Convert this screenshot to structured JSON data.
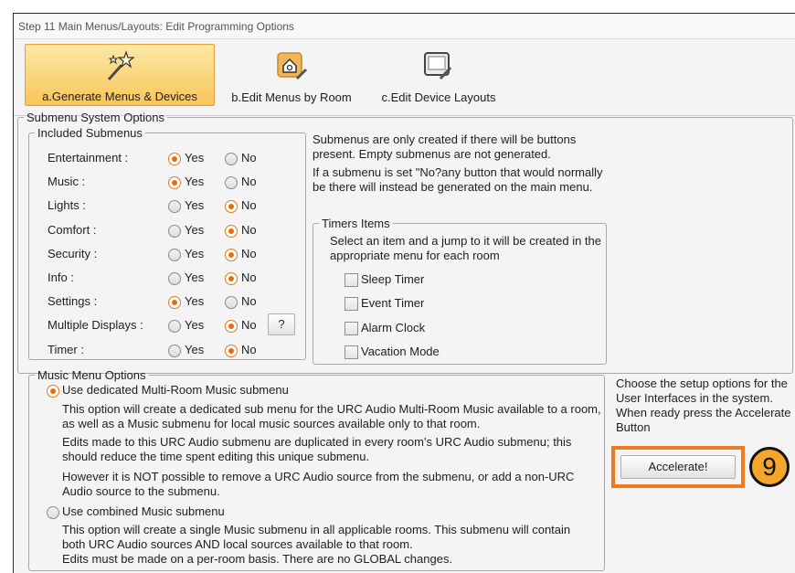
{
  "window": {
    "title": "Step 11 Main Menus/Layouts: Edit Programming Options"
  },
  "toolbar": {
    "generate_label": "a.Generate Menus & Devices",
    "edit_menus_label": "b.Edit Menus by Room",
    "edit_layouts_label": "c.Edit Device Layouts"
  },
  "submenu": {
    "legend": "Submenu System Options",
    "included_legend": "Included Submenus",
    "yes_label": "Yes",
    "no_label": "No",
    "help_label": "?",
    "rows": [
      {
        "label": "Entertainment :",
        "selected": "Yes"
      },
      {
        "label": "Music :",
        "selected": "Yes"
      },
      {
        "label": "Lights :",
        "selected": "No"
      },
      {
        "label": "Comfort :",
        "selected": "No"
      },
      {
        "label": "Security :",
        "selected": "No"
      },
      {
        "label": "Info :",
        "selected": "No"
      },
      {
        "label": "Settings :",
        "selected": "Yes"
      },
      {
        "label": "Multiple Displays :",
        "selected": "No"
      },
      {
        "label": "Timer :",
        "selected": "No"
      }
    ],
    "info_1": "Submenus are only created if there will be buttons present. Empty submenus are not generated.",
    "info_2": "If a submenu is set \"No?any button that would normally be there will instead be generated on the main menu."
  },
  "timers": {
    "legend": "Timers Items",
    "description": "Select an item and a jump to it  will be created in the appropriate menu for each room",
    "items": [
      {
        "label": "Sleep Timer",
        "checked": false
      },
      {
        "label": "Event Timer",
        "checked": false
      },
      {
        "label": "Alarm Clock",
        "checked": false
      },
      {
        "label": "Vacation Mode",
        "checked": false
      }
    ]
  },
  "music": {
    "legend": "Music Menu Options",
    "option1_label": "Use dedicated Multi-Room Music submenu",
    "option1_selected": true,
    "option1_desc1": "This option will create a dedicated sub menu for the URC Audio Multi-Room Music available to a room, as well as a Music submenu for local music sources available only to that room.",
    "option1_desc2": "Edits made to this URC Audio submenu are duplicated in every room's URC Audio submenu; this should reduce the time spent editing this unique submenu.",
    "option1_desc3": "However it is NOT possible to remove a URC Audio source from the submenu, or add a non-URC Audio source to the submenu.",
    "option2_label": "Use combined Music submenu",
    "option2_selected": false,
    "option2_desc": "This option will create a single Music submenu in all applicable rooms. This submenu will contain both URC Audio sources AND local sources available to that room.",
    "option2_desc2": "Edits must be made on a per-room basis. There are no GLOBAL changes."
  },
  "side": {
    "instructions": "Choose the setup options for the User Interfaces in the system. When ready press the Accelerate Button",
    "accelerate_label": "Accelerate!",
    "step_badge": "9"
  },
  "colors": {
    "highlight": "#ef7b1c",
    "active_tab": "#f7c55c",
    "radio_on": "#e46d10"
  }
}
